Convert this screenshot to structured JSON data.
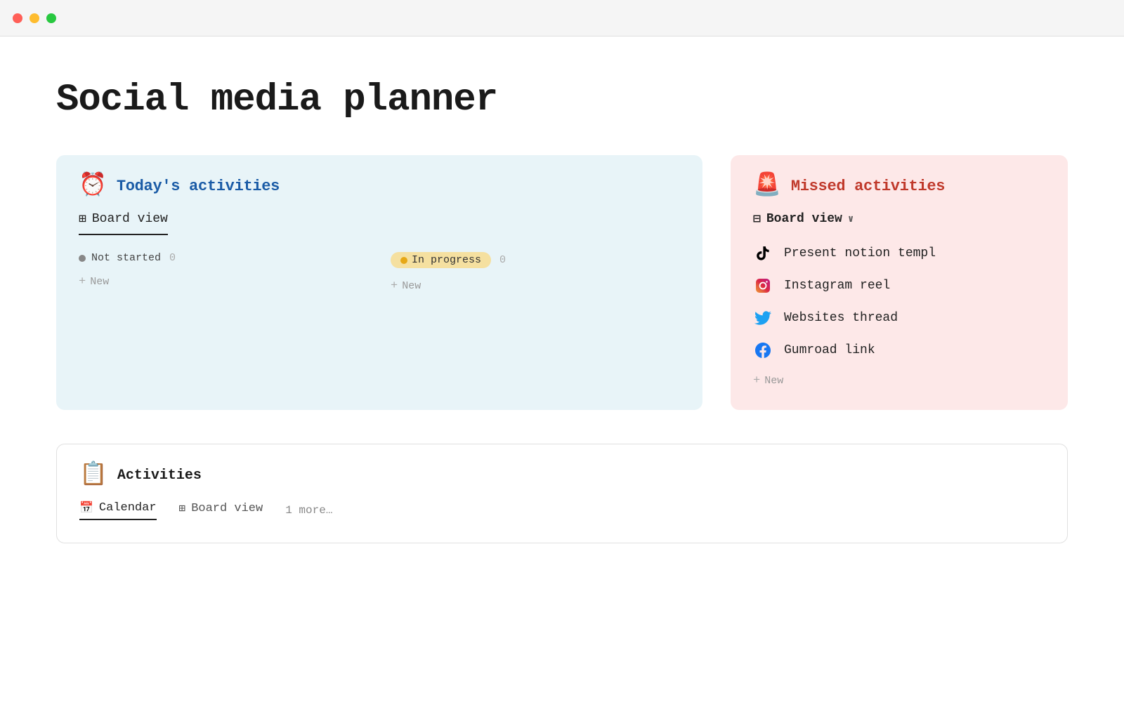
{
  "titlebar": {
    "traffic_red": "close",
    "traffic_yellow": "minimize",
    "traffic_green": "maximize"
  },
  "page": {
    "title": "Social media planner"
  },
  "today_card": {
    "icon": "⏰",
    "title": "Today's activities",
    "view_label": "Board view",
    "view_icon": "⊞",
    "columns": [
      {
        "label": "Not started",
        "dot_color": "gray",
        "count": "0",
        "new_label": "New"
      },
      {
        "label": "In progress",
        "dot_color": "orange",
        "count": "0",
        "new_label": "New"
      }
    ]
  },
  "missed_card": {
    "icon": "🚨",
    "title": "Missed activities",
    "view_label": "Board view",
    "view_icon": "⊟",
    "items": [
      {
        "platform": "tiktok",
        "label": "Present notion templ"
      },
      {
        "platform": "instagram",
        "label": "Instagram reel"
      },
      {
        "platform": "twitter",
        "label": "Websites thread"
      },
      {
        "platform": "facebook",
        "label": "Gumroad link"
      }
    ],
    "new_label": "New"
  },
  "activities_section": {
    "icon": "📋",
    "title": "Activities",
    "tabs": [
      {
        "label": "Calendar",
        "icon": "📅",
        "active": true
      },
      {
        "label": "Board view",
        "icon": "⊞",
        "active": false
      }
    ],
    "more_label": "1 more…"
  }
}
